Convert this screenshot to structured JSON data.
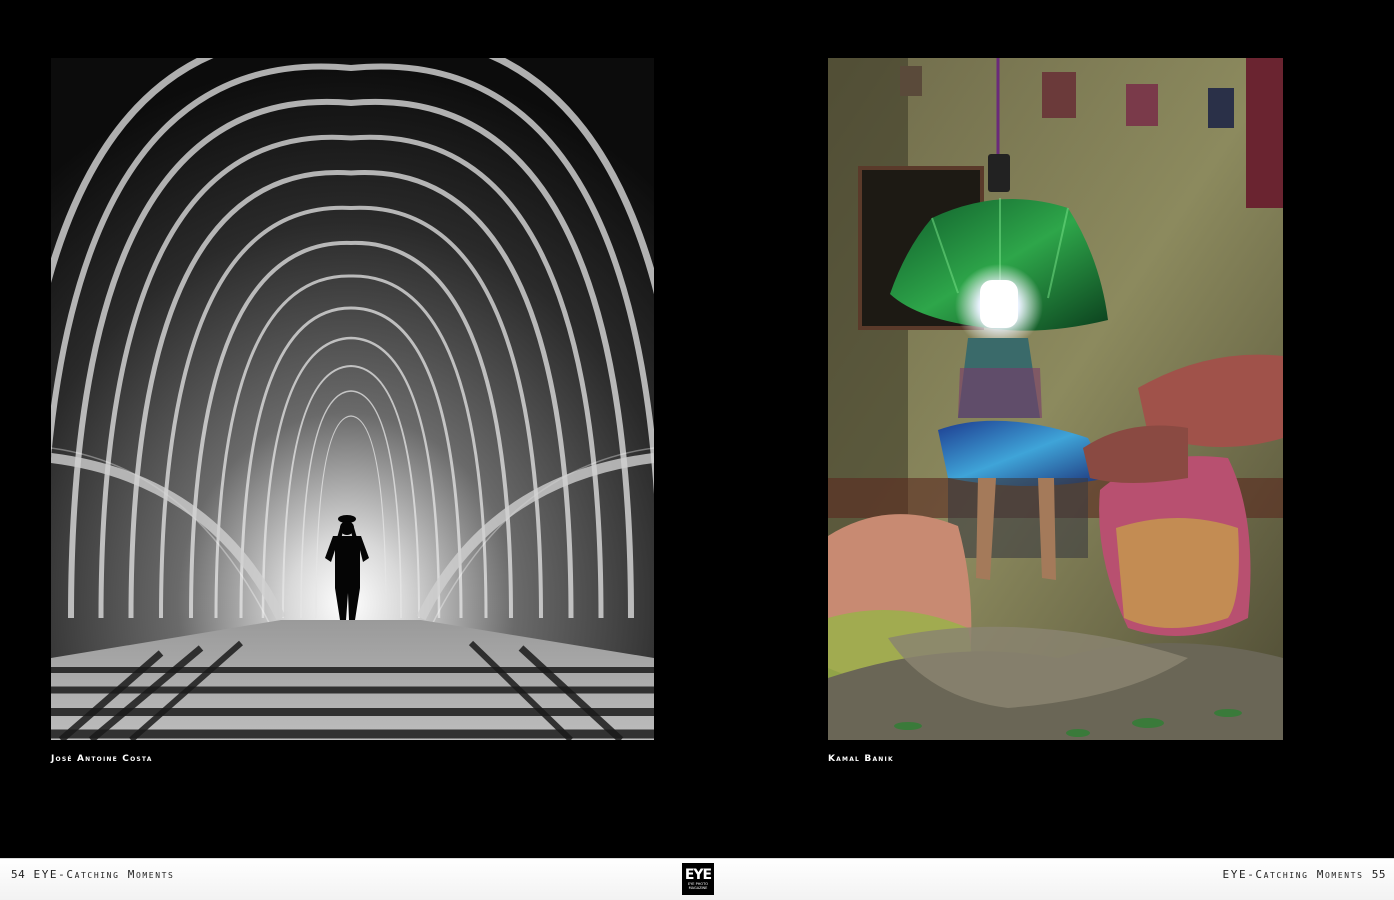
{
  "photos": {
    "left": {
      "credit": "José Antoine Costa"
    },
    "right": {
      "credit": "Kamal Banik"
    }
  },
  "footer": {
    "left_page_number": "54",
    "left_section_title": "EYE-Catching Moments",
    "right_section_title": "EYE-Catching Moments",
    "right_page_number": "55",
    "logo": {
      "mark": "EYE",
      "subtitle_line1": "EYE PHOTO",
      "subtitle_line2": "MAGAZINE"
    }
  }
}
